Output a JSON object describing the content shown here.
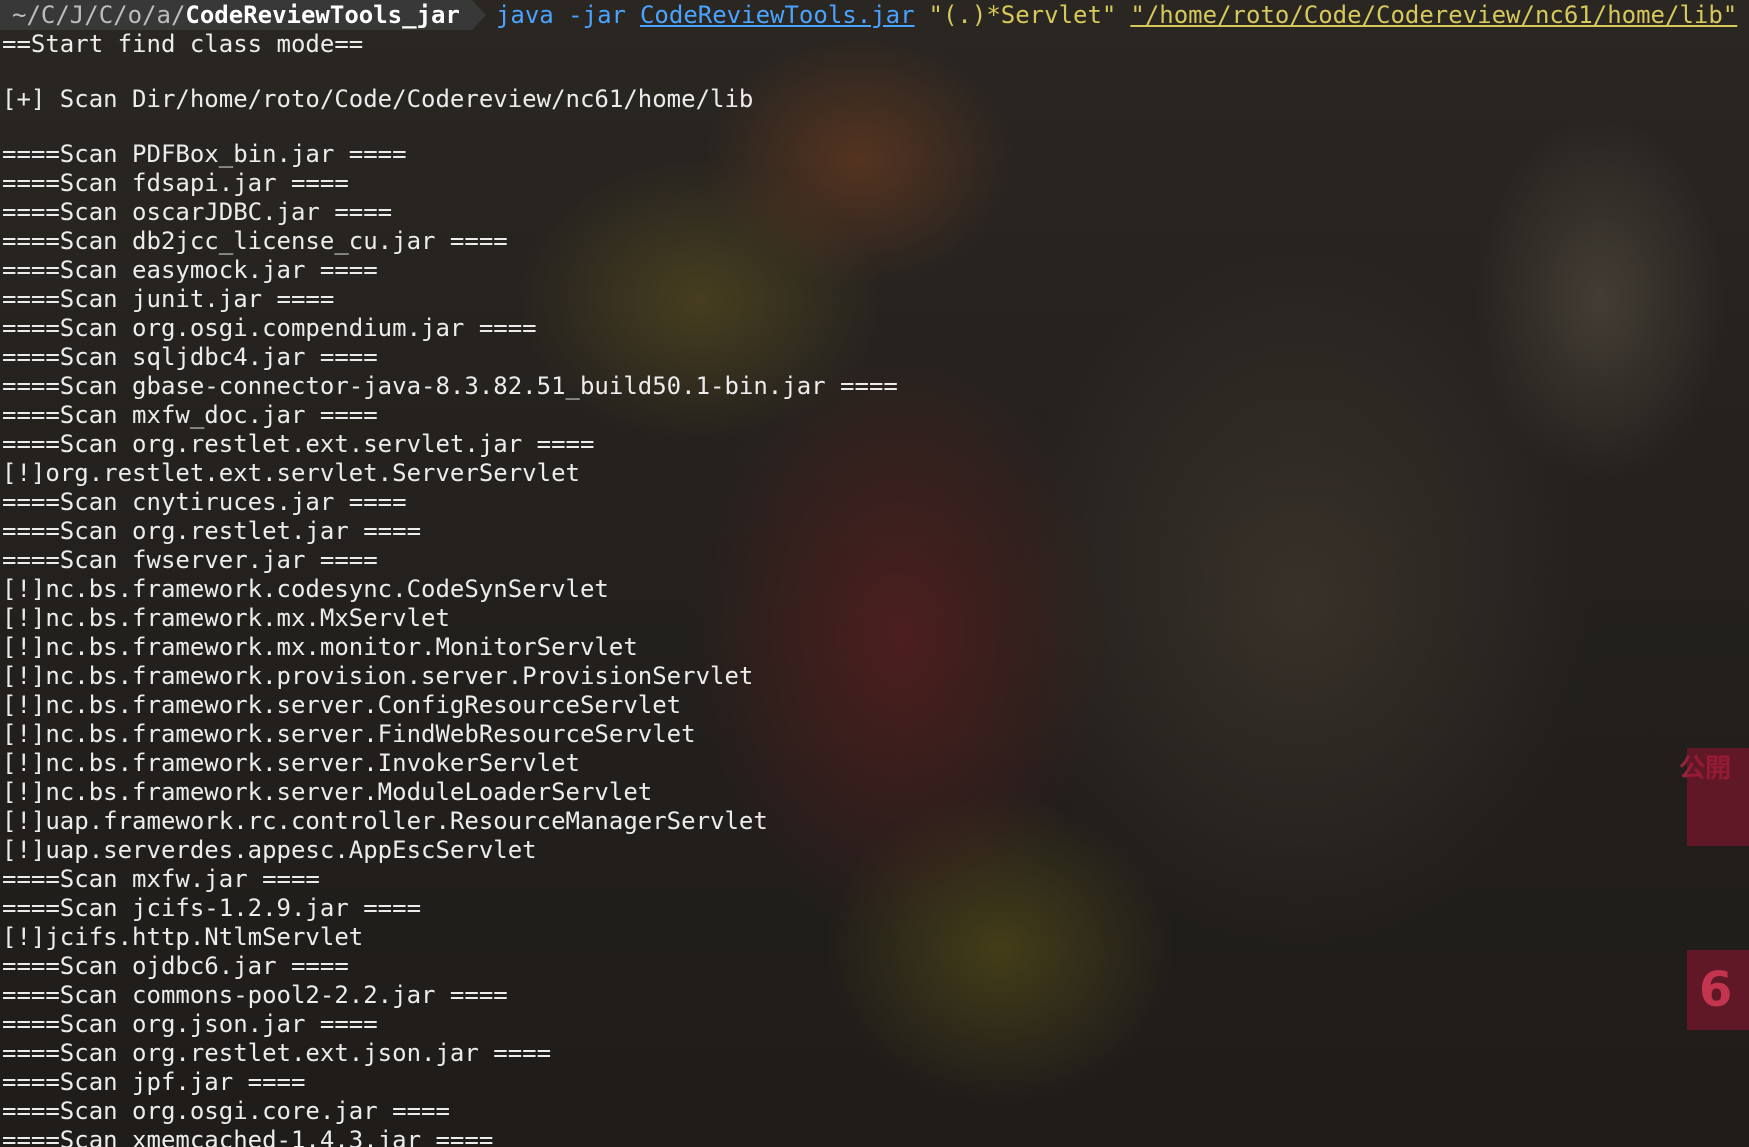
{
  "prompt": {
    "path_prefix": "~/C/J/C/o/a/",
    "path_current": "CodeReviewTools_jar",
    "command": "java -jar",
    "jar_file": "CodeReviewTools.jar",
    "pattern": "\"(.)*Servlet\"",
    "target_path": "\"/home/roto/Code/Codereview/nc61/home/lib\""
  },
  "output": {
    "header": "==Start find class mode==",
    "scan_dir": "[+] Scan Dir/home/roto/Code/Codereview/nc61/home/lib",
    "lines": [
      "====Scan PDFBox_bin.jar ====",
      "====Scan fdsapi.jar ====",
      "====Scan oscarJDBC.jar ====",
      "====Scan db2jcc_license_cu.jar ====",
      "====Scan easymock.jar ====",
      "====Scan junit.jar ====",
      "====Scan org.osgi.compendium.jar ====",
      "====Scan sqljdbc4.jar ====",
      "====Scan gbase-connector-java-8.3.82.51_build50.1-bin.jar ====",
      "====Scan mxfw_doc.jar ====",
      "====Scan org.restlet.ext.servlet.jar ====",
      "[!]org.restlet.ext.servlet.ServerServlet",
      "====Scan cnytiruces.jar ====",
      "====Scan org.restlet.jar ====",
      "====Scan fwserver.jar ====",
      "[!]nc.bs.framework.codesync.CodeSynServlet",
      "[!]nc.bs.framework.mx.MxServlet",
      "[!]nc.bs.framework.mx.monitor.MonitorServlet",
      "[!]nc.bs.framework.provision.server.ProvisionServlet",
      "[!]nc.bs.framework.server.ConfigResourceServlet",
      "[!]nc.bs.framework.server.FindWebResourceServlet",
      "[!]nc.bs.framework.server.InvokerServlet",
      "[!]nc.bs.framework.server.ModuleLoaderServlet",
      "[!]uap.framework.rc.controller.ResourceManagerServlet",
      "[!]uap.serverdes.appesc.AppEscServlet",
      "====Scan mxfw.jar ====",
      "====Scan jcifs-1.2.9.jar ====",
      "[!]jcifs.http.NtlmServlet",
      "====Scan ojdbc6.jar ====",
      "====Scan commons-pool2-2.2.jar ====",
      "====Scan org.json.jar ====",
      "====Scan org.restlet.ext.json.jar ====",
      "====Scan jpf.jar ====",
      "====Scan org.osgi.core.jar ====",
      "====Scan xmemcached-1.4.3.jar ===="
    ]
  },
  "background": {
    "badge_top_text": "公開",
    "badge_bottom_text": "6"
  },
  "colors": {
    "command_blue": "#4aa3ff",
    "string_yellow": "#d6c85a",
    "prompt_bg": "#383838",
    "text": "#ececec"
  }
}
